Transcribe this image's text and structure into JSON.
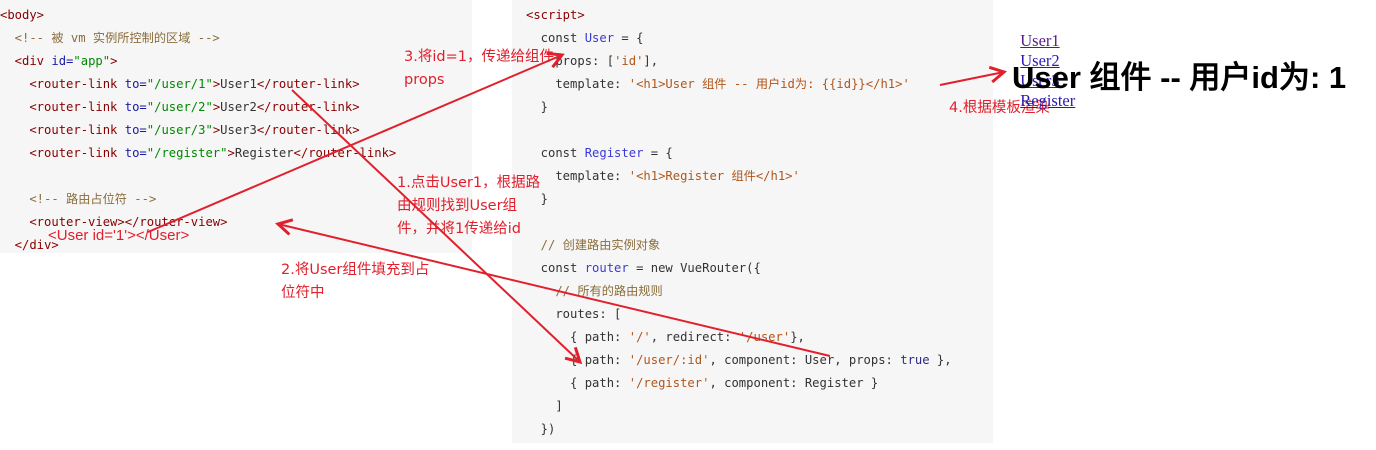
{
  "left_code": {
    "lines": [
      [
        {
          "t": "<body>",
          "c": "tag"
        }
      ],
      [
        {
          "t": "  <!-- 被 vm 实例所控制的区域 -->",
          "c": "comment"
        }
      ],
      [
        {
          "t": "  <div ",
          "c": "tag"
        },
        {
          "t": "id=",
          "c": "attr"
        },
        {
          "t": "\"app\"",
          "c": "val"
        },
        {
          "t": ">",
          "c": "tag"
        }
      ],
      [
        {
          "t": "    <router-link ",
          "c": "tag"
        },
        {
          "t": "to=",
          "c": "attr"
        },
        {
          "t": "\"/user/1\"",
          "c": "val"
        },
        {
          "t": ">",
          "c": "tag"
        },
        {
          "t": "User1",
          "c": "plain"
        },
        {
          "t": "</router-link>",
          "c": "tag"
        }
      ],
      [
        {
          "t": "    <router-link ",
          "c": "tag"
        },
        {
          "t": "to=",
          "c": "attr"
        },
        {
          "t": "\"/user/2\"",
          "c": "val"
        },
        {
          "t": ">",
          "c": "tag"
        },
        {
          "t": "User2",
          "c": "plain"
        },
        {
          "t": "</router-link>",
          "c": "tag"
        }
      ],
      [
        {
          "t": "    <router-link ",
          "c": "tag"
        },
        {
          "t": "to=",
          "c": "attr"
        },
        {
          "t": "\"/user/3\"",
          "c": "val"
        },
        {
          "t": ">",
          "c": "tag"
        },
        {
          "t": "User3",
          "c": "plain"
        },
        {
          "t": "</router-link>",
          "c": "tag"
        }
      ],
      [
        {
          "t": "    <router-link ",
          "c": "tag"
        },
        {
          "t": "to=",
          "c": "attr"
        },
        {
          "t": "\"/register\"",
          "c": "val"
        },
        {
          "t": ">",
          "c": "tag"
        },
        {
          "t": "Register",
          "c": "plain"
        },
        {
          "t": "</router-link>",
          "c": "tag"
        }
      ],
      [
        {
          "t": "",
          "c": "plain"
        }
      ],
      [
        {
          "t": "    <!-- 路由占位符 -->",
          "c": "comment"
        }
      ],
      [
        {
          "t": "    <router-view></router-view>",
          "c": "tag"
        }
      ],
      [
        {
          "t": "  </div>",
          "c": "tag"
        }
      ]
    ]
  },
  "right_code": {
    "lines": [
      [
        {
          "t": "<script>",
          "c": "tag"
        }
      ],
      [
        {
          "t": "  const ",
          "c": "kw"
        },
        {
          "t": "User",
          "c": "cls"
        },
        {
          "t": " = {",
          "c": "plain"
        }
      ],
      [
        {
          "t": "    props: [",
          "c": "plain"
        },
        {
          "t": "'id'",
          "c": "str"
        },
        {
          "t": "],",
          "c": "plain"
        }
      ],
      [
        {
          "t": "    template: ",
          "c": "plain"
        },
        {
          "t": "'<h1>User 组件 -- 用户id为: {{id}}</h1>'",
          "c": "str"
        }
      ],
      [
        {
          "t": "  }",
          "c": "plain"
        }
      ],
      [
        {
          "t": "",
          "c": "plain"
        }
      ],
      [
        {
          "t": "  const ",
          "c": "kw"
        },
        {
          "t": "Register",
          "c": "cls"
        },
        {
          "t": " = {",
          "c": "plain"
        }
      ],
      [
        {
          "t": "    template: ",
          "c": "plain"
        },
        {
          "t": "'<h1>Register 组件</h1>'",
          "c": "str"
        }
      ],
      [
        {
          "t": "  }",
          "c": "plain"
        }
      ],
      [
        {
          "t": "",
          "c": "plain"
        }
      ],
      [
        {
          "t": "  // 创建路由实例对象",
          "c": "comment"
        }
      ],
      [
        {
          "t": "  const ",
          "c": "kw"
        },
        {
          "t": "router",
          "c": "cls"
        },
        {
          "t": " = new VueRouter({",
          "c": "plain"
        }
      ],
      [
        {
          "t": "    // 所有的路由规则",
          "c": "comment"
        }
      ],
      [
        {
          "t": "    routes: [",
          "c": "plain"
        }
      ],
      [
        {
          "t": "      { path: ",
          "c": "plain"
        },
        {
          "t": "'/'",
          "c": "str"
        },
        {
          "t": ", redirect: ",
          "c": "plain"
        },
        {
          "t": "'/user'",
          "c": "str"
        },
        {
          "t": "},",
          "c": "plain"
        }
      ],
      [
        {
          "t": "      { path: ",
          "c": "plain"
        },
        {
          "t": "'/user/:id'",
          "c": "str"
        },
        {
          "t": ", component: User, props: ",
          "c": "plain"
        },
        {
          "t": "true",
          "c": "lit"
        },
        {
          "t": " },",
          "c": "plain"
        }
      ],
      [
        {
          "t": "      { path: ",
          "c": "plain"
        },
        {
          "t": "'/register'",
          "c": "str"
        },
        {
          "t": ", component: Register }",
          "c": "plain"
        }
      ],
      [
        {
          "t": "    ]",
          "c": "plain"
        }
      ],
      [
        {
          "t": "  })",
          "c": "plain"
        }
      ]
    ]
  },
  "overlay_user_tag": "<User id='1'></User>",
  "annotations": {
    "step1": "1.点击User1，根据路\n由规则找到User组\n件，并将1传递给id",
    "step2": "2.将User组件填充到占\n位符中",
    "step3": "3.将id=1，传递给组件\nprops",
    "step4": "4.根据模板渲染"
  },
  "nav_links": [
    "User1",
    "User2",
    "User3",
    "Register"
  ],
  "result_heading": "User 组件 -- 用户id为: 1",
  "colors": {
    "annotation": "#e0202c",
    "link": "#2a1ab0",
    "visited_link": "#551a8b"
  }
}
